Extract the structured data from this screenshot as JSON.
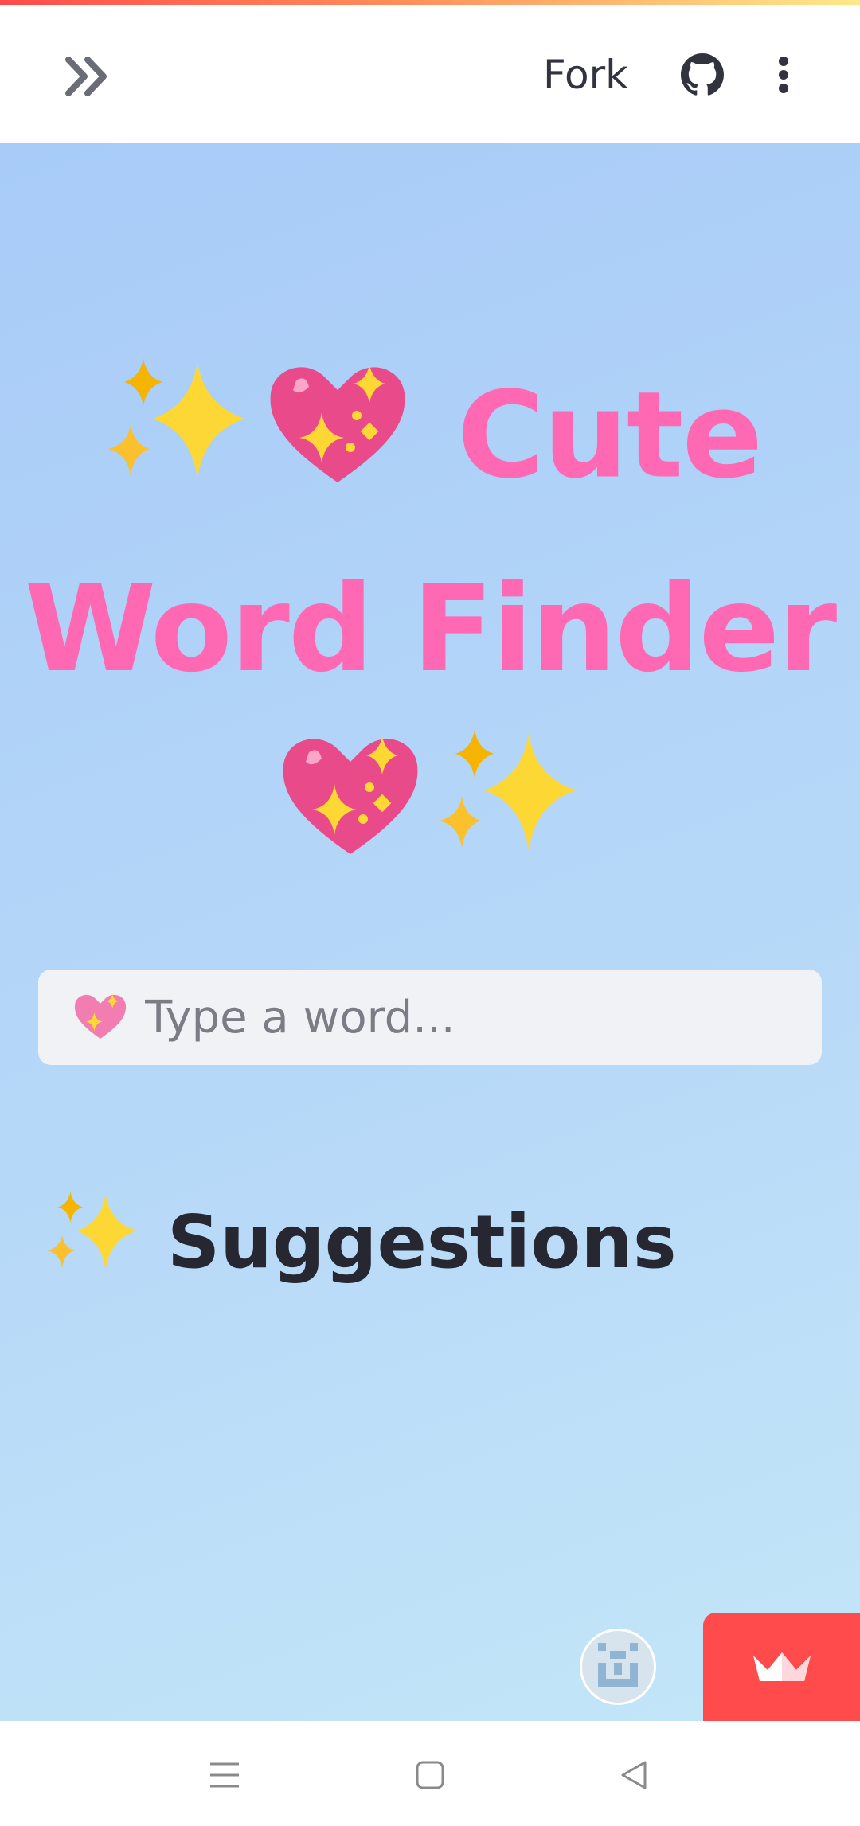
{
  "header": {
    "fork_label": "Fork",
    "icons": {
      "expand": "chevrons-right-icon",
      "github": "github-icon",
      "menu": "vertical-dots-icon"
    }
  },
  "main": {
    "title_text": "Cute Word Finder",
    "title_emoji_leading": [
      "sparkles",
      "sparkling-heart"
    ],
    "title_emoji_trailing": [
      "sparkling-heart",
      "sparkles"
    ],
    "search": {
      "placeholder": "Type a word...",
      "value": "",
      "icon": "sparkling-heart-icon"
    },
    "suggestions_heading": "Suggestions",
    "suggestions_icon": "sparkles-icon"
  },
  "floating": {
    "avatar_icon": "pixel-avatar-icon",
    "crown_icon": "crown-icon"
  },
  "navbar": {
    "icons": [
      "menu-lines-icon",
      "home-square-icon",
      "back-triangle-icon"
    ]
  },
  "colors": {
    "title": "#ff69b4",
    "accent_red": "#ff4b4b",
    "text_dark": "#262730",
    "input_bg": "#f0f2f6"
  }
}
